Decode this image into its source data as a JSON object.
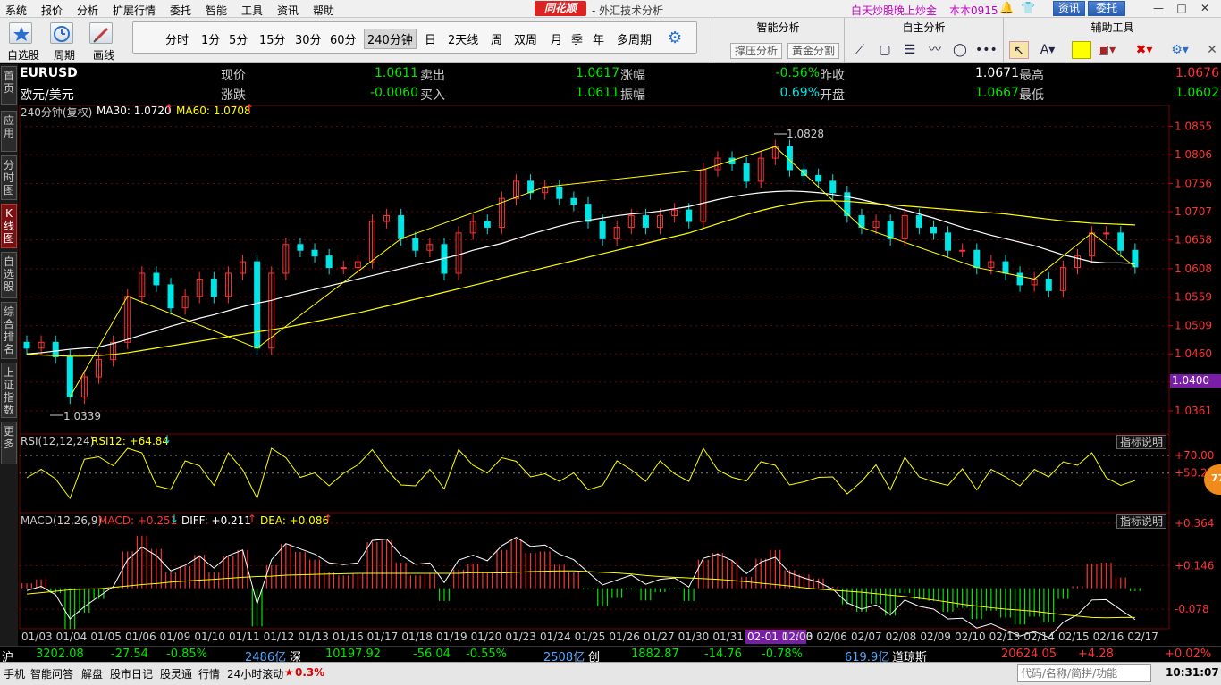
{
  "menu": {
    "items": [
      "系统",
      "报价",
      "分析",
      "扩展行情",
      "委托",
      "智能",
      "工具",
      "资讯",
      "帮助"
    ],
    "brand": "同花顺",
    "app_title": "- 外汇技术分析",
    "promo": "白天炒股晚上炒金",
    "account": "本本0915",
    "btn_news": "资讯",
    "btn_trade": "委托"
  },
  "toolbar": {
    "left_buttons": [
      {
        "label": "自选股",
        "icon": "star-list-icon"
      },
      {
        "label": "周期",
        "icon": "clock-icon"
      },
      {
        "label": "画线",
        "icon": "pencil-icon"
      }
    ],
    "periods": [
      "分时",
      "1分",
      "5分",
      "15分",
      "30分",
      "60分",
      "240分钟",
      "日",
      "2天线",
      "周",
      "双周",
      "月",
      "季",
      "年",
      "多周期"
    ],
    "active_period": "240分钟",
    "smart_panel": {
      "title": "智能分析",
      "buttons": [
        "撑压分析",
        "黄金分割"
      ]
    },
    "draw_panel": {
      "title": "自主分析"
    },
    "aux_panel": {
      "title": "辅助工具"
    }
  },
  "sidetabs": [
    "首页",
    "应用",
    "分时图",
    "K线图",
    "自选股",
    "综合排名",
    "上证指数",
    "更多"
  ],
  "quote": {
    "symbol": "EURUSD",
    "name": "欧元/美元",
    "rows": [
      [
        {
          "label": "现价",
          "value": "1.0611",
          "color": "green"
        },
        {
          "label": "卖出",
          "value": "1.0617",
          "color": "green"
        },
        {
          "label": "涨幅",
          "value": "-0.56%",
          "color": "green"
        },
        {
          "label": "昨收",
          "value": "1.0671",
          "color": "white"
        },
        {
          "label": "最高",
          "value": "1.0676",
          "color": "red"
        }
      ],
      [
        {
          "label": "涨跌",
          "value": "-0.0060",
          "color": "green"
        },
        {
          "label": "买入",
          "value": "1.0611",
          "color": "green"
        },
        {
          "label": "振幅",
          "value": "0.69%",
          "color": "cyan"
        },
        {
          "label": "开盘",
          "value": "1.0667",
          "color": "green"
        },
        {
          "label": "最低",
          "value": "1.0602",
          "color": "green"
        }
      ]
    ]
  },
  "main_indicator": {
    "period_label": "240分钟(复权)",
    "ma30": "MA30: 1.0720",
    "ma60": "MA60: 1.0708",
    "high_label": "1.0828",
    "low_label": "1.0339",
    "current_price_tag": "1.0400"
  },
  "rsi": {
    "label": "RSI(12,12,24)",
    "value": "RSI12: +64.84",
    "help": "指标说明",
    "badge": "77"
  },
  "macd": {
    "label": "MACD(12,26,9)",
    "macd": "MACD: +0.251",
    "diff": "DIFF: +0.211",
    "dea": "DEA: +0.086",
    "help": "指标说明"
  },
  "chart_data": {
    "type": "candlestick",
    "price_axis": [
      "1.0855",
      "1.0806",
      "1.0756",
      "1.0707",
      "1.0658",
      "1.0608",
      "1.0559",
      "1.0509",
      "1.0460",
      "1.0411",
      "1.0361"
    ],
    "rsi_axis": [
      "+70.00",
      "+50.28"
    ],
    "macd_axis": [
      "+0.364",
      "+0.146",
      "-0.078"
    ],
    "x_labels": [
      "01/03",
      "01/04",
      "01/05",
      "01/06",
      "01/09",
      "01/10",
      "01/11",
      "01/12",
      "01/13",
      "01/16",
      "01/17",
      "01/18",
      "01/19",
      "01/20",
      "01/23",
      "01/24",
      "01/25",
      "01/26",
      "01/27",
      "01/30",
      "01/31",
      "02-01 12:00",
      "02/03",
      "02/06",
      "02/07",
      "02/08",
      "02/09",
      "02/10",
      "02/13",
      "02/14",
      "02/15",
      "02/16",
      "02/17"
    ],
    "highlight_label": "02-01 12:00",
    "close_series": [
      1.047,
      1.048,
      1.0455,
      1.0385,
      1.042,
      1.045,
      1.048,
      1.056,
      1.06,
      1.058,
      1.054,
      1.056,
      1.059,
      1.056,
      1.06,
      1.062,
      1.047,
      1.06,
      1.065,
      1.064,
      1.063,
      1.061,
      1.061,
      1.062,
      1.069,
      1.07,
      1.066,
      1.064,
      1.065,
      1.06,
      1.067,
      1.069,
      1.068,
      1.073,
      1.076,
      1.074,
      1.075,
      1.073,
      1.072,
      1.069,
      1.066,
      1.068,
      1.07,
      1.068,
      1.07,
      1.071,
      1.069,
      1.078,
      1.08,
      1.079,
      1.076,
      1.08,
      1.082,
      1.078,
      1.077,
      1.076,
      1.074,
      1.07,
      1.068,
      1.069,
      1.066,
      1.07,
      1.068,
      1.067,
      1.064,
      1.064,
      1.061,
      1.062,
      1.06,
      1.058,
      1.059,
      1.057,
      1.061,
      1.063,
      1.067,
      1.067,
      1.064,
      1.0611
    ],
    "ma30": [
      1.046,
      1.0462,
      1.0465,
      1.0468,
      1.047,
      1.0472,
      1.0478,
      1.0485,
      1.0493,
      1.05,
      1.0508,
      1.0515,
      1.0522,
      1.0528,
      1.0535,
      1.0542,
      1.0548,
      1.0553,
      1.056,
      1.0566,
      1.0572,
      1.0578,
      1.0584,
      1.059,
      1.0596,
      1.0602,
      1.0608,
      1.0614,
      1.062,
      1.0626,
      1.0632,
      1.064,
      1.0646,
      1.0652,
      1.066,
      1.0668,
      1.0675,
      1.0682,
      1.0688,
      1.0692,
      1.0696,
      1.07,
      1.0703,
      1.0705,
      1.0708,
      1.0712,
      1.0716,
      1.0722,
      1.0728,
      1.0733,
      1.0737,
      1.074,
      1.0742,
      1.0743,
      1.0742,
      1.074,
      1.0737,
      1.0733,
      1.0728,
      1.0722,
      1.0716,
      1.071,
      1.0703,
      1.0696,
      1.0688,
      1.068,
      1.0673,
      1.0666,
      1.066,
      1.0654,
      1.0648,
      1.064,
      1.0632,
      1.0626,
      1.062,
      1.0618,
      1.0618,
      1.0617
    ],
    "ma60": [
      1.046,
      1.0458,
      1.0457,
      1.0456,
      1.0456,
      1.0457,
      1.0459,
      1.0462,
      1.0466,
      1.047,
      1.0474,
      1.0478,
      1.0482,
      1.0486,
      1.049,
      1.0494,
      1.0498,
      1.0502,
      1.0506,
      1.0511,
      1.0516,
      1.0521,
      1.0526,
      1.0531,
      1.0537,
      1.0543,
      1.0549,
      1.0555,
      1.0561,
      1.0567,
      1.0573,
      1.0579,
      1.0585,
      1.0592,
      1.0598,
      1.0604,
      1.061,
      1.0616,
      1.0622,
      1.0628,
      1.0634,
      1.064,
      1.0646,
      1.0652,
      1.0658,
      1.0664,
      1.067,
      1.0678,
      1.0686,
      1.0694,
      1.0702,
      1.0709,
      1.0715,
      1.072,
      1.0724,
      1.0726,
      1.0726,
      1.0725,
      1.0723,
      1.0721,
      1.0719,
      1.0717,
      1.0715,
      1.0713,
      1.0711,
      1.0709,
      1.0707,
      1.0705,
      1.0703,
      1.07,
      1.0697,
      1.0694,
      1.0691,
      1.0689,
      1.0687,
      1.0686,
      1.0685,
      1.0684
    ]
  },
  "indexbar": {
    "sh": {
      "label": "沪",
      "value": "3202.08",
      "change": "-27.54",
      "pct": "-0.85%",
      "amount": "2486亿"
    },
    "sz": {
      "label": "深",
      "value": "10197.92",
      "change": "-56.04",
      "pct": "-0.55%",
      "amount": "2508亿"
    },
    "cy": {
      "label": "创",
      "value": "1882.87",
      "change": "-14.76",
      "pct": "-0.78%",
      "amount": "619.9亿"
    },
    "dj": {
      "label": "道琼斯",
      "value": "20624.05",
      "change": "+4.28",
      "pct": "+0.02%"
    }
  },
  "statusbar": {
    "items": [
      "手机",
      "智能问答",
      "解盘",
      "股市日记",
      "股灵通",
      "行情"
    ],
    "scroll_label": "24小时滚动",
    "scroll_value": "0.3%",
    "search_placeholder": "代码/名称/简拼/功能",
    "clock": "10:31:07"
  },
  "colors": {
    "up": "#ff3232",
    "down": "#00e5e5",
    "ma30": "#ffffff",
    "ma60": "#ffff00",
    "grid": "#7a0000"
  }
}
